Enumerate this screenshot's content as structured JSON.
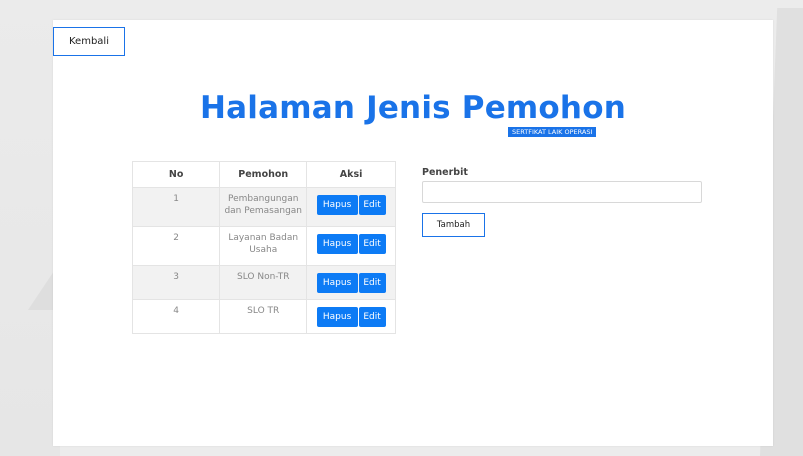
{
  "nav": {
    "back_label": "Kembali"
  },
  "page": {
    "title": "Halaman Jenis Pemohon",
    "badge": "SERTFIKAT LAIK OPERASI"
  },
  "table": {
    "headers": [
      "No",
      "Pemohon",
      "Aksi"
    ],
    "rows": [
      {
        "no": "1",
        "pemohon_line1": "Pembangungan",
        "pemohon_line2": "dan Pemasangan"
      },
      {
        "no": "2",
        "pemohon_line1": "Layanan Badan",
        "pemohon_line2": "Usaha"
      },
      {
        "no": "3",
        "pemohon_line1": "SLO Non-TR",
        "pemohon_line2": ""
      },
      {
        "no": "4",
        "pemohon_line1": "SLO TR",
        "pemohon_line2": ""
      }
    ],
    "delete_label": "Hapus",
    "edit_label": "Edit"
  },
  "form": {
    "label": "Penerbit",
    "input_value": "",
    "submit_label": "Tambah"
  },
  "colors": {
    "accent": "#1a73e8",
    "button": "#0d7bf5",
    "row_alt": "#f2f2f2"
  }
}
